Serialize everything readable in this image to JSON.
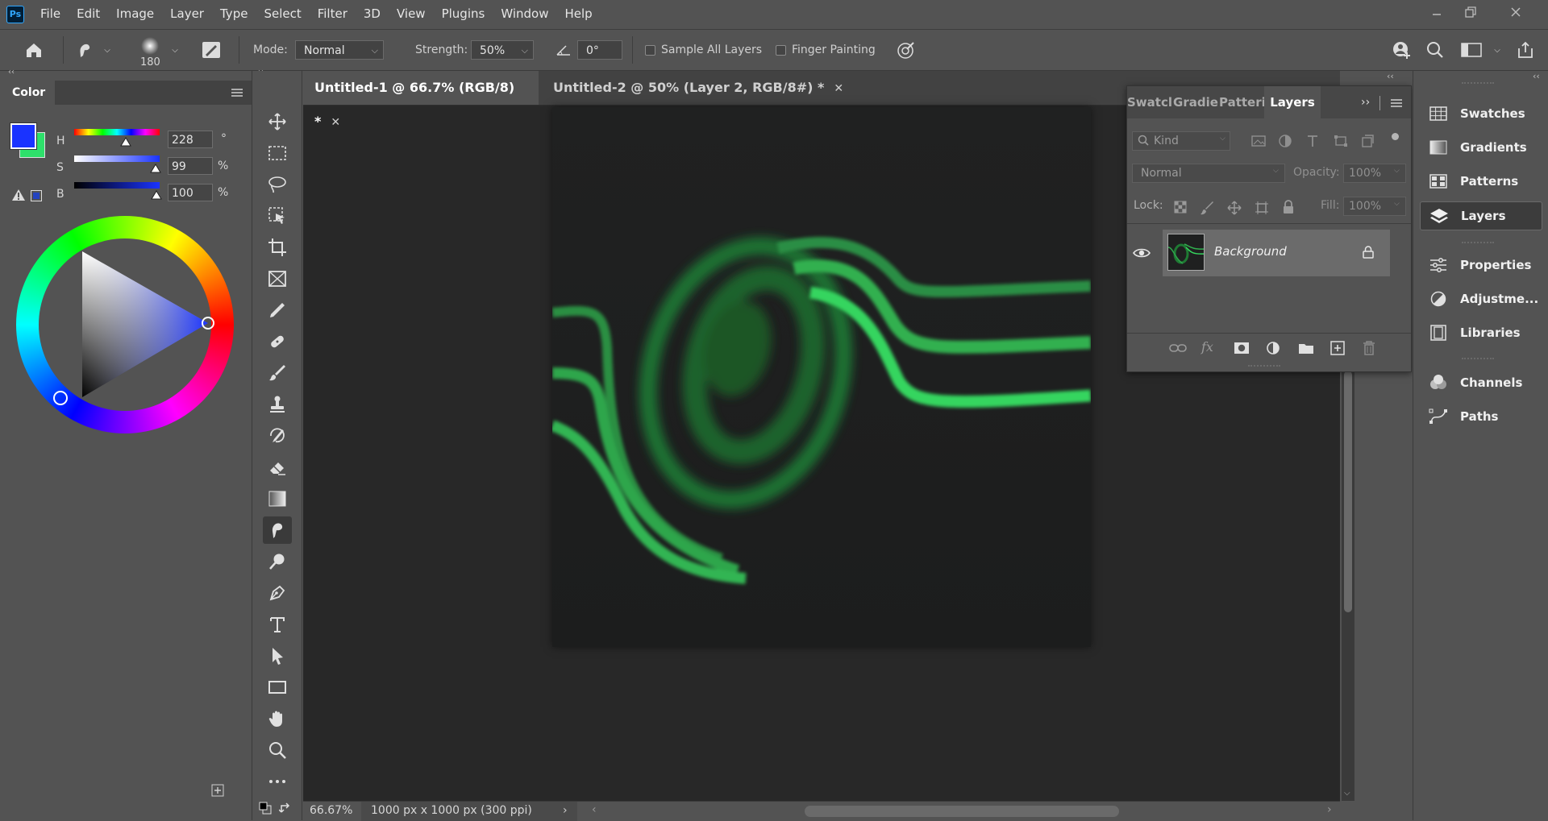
{
  "app": {
    "logo_text": "Ps"
  },
  "menu": [
    "File",
    "Edit",
    "Image",
    "Layer",
    "Type",
    "Select",
    "Filter",
    "3D",
    "View",
    "Plugins",
    "Window",
    "Help"
  ],
  "window_controls": {
    "minimize": "minimize-icon",
    "restore": "restore-icon",
    "close": "close-icon"
  },
  "options_bar": {
    "brush_size": "180",
    "mode_label": "Mode:",
    "mode_value": "Normal",
    "strength_label": "Strength:",
    "strength_value": "50%",
    "angle_value": "0°",
    "sample_all_layers_label": "Sample All Layers",
    "finger_painting_label": "Finger Painting"
  },
  "color_panel": {
    "title": "Color",
    "h_label": "H",
    "h_value": "228",
    "h_unit": "°",
    "s_label": "S",
    "s_value": "99",
    "s_unit": "%",
    "b_label": "B",
    "b_value": "100",
    "b_unit": "%",
    "foreground_color": "#1a33ff",
    "background_color": "#2ee06b"
  },
  "tools": [
    "move-tool",
    "marquee-tool",
    "lasso-tool",
    "object-select-tool",
    "crop-tool",
    "frame-tool",
    "eyedropper-tool",
    "healing-brush-tool",
    "brush-tool",
    "clone-stamp-tool",
    "history-brush-tool",
    "eraser-tool",
    "gradient-tool",
    "smudge-tool",
    "dodge-tool",
    "pen-tool",
    "type-tool",
    "path-select-tool",
    "rectangle-tool",
    "hand-tool",
    "zoom-tool",
    "more-tools"
  ],
  "active_tool": "smudge-tool",
  "document_tabs": [
    {
      "label": "Untitled-1 @ 66.7% (RGB/8) *",
      "active": true
    },
    {
      "label": "Untitled-2 @ 50% (Layer 2, RGB/8#) *",
      "active": false
    }
  ],
  "status_bar": {
    "zoom": "66.67%",
    "doc_info": "1000 px x 1000 px (300 ppi)"
  },
  "layers_panel": {
    "tabs": [
      "Swatcl",
      "Gradie",
      "Patteri",
      "Layers"
    ],
    "active_tab": "Layers",
    "filter_placeholder": "Kind",
    "blend_mode": "Normal",
    "opacity_label": "Opacity:",
    "opacity_value": "100%",
    "lock_label": "Lock:",
    "fill_label": "Fill:",
    "fill_value": "100%",
    "layers": [
      {
        "name": "Background",
        "visible": true,
        "locked": true
      }
    ]
  },
  "right_dock": {
    "group1": [
      "Swatches",
      "Gradients",
      "Patterns",
      "Layers"
    ],
    "group2": [
      "Properties",
      "Adjustme...",
      "Libraries"
    ],
    "group3": [
      "Channels",
      "Paths"
    ],
    "active": "Layers"
  },
  "colors": {
    "accent_green": "#2ee06b",
    "fg_blue": "#1a33ff"
  }
}
